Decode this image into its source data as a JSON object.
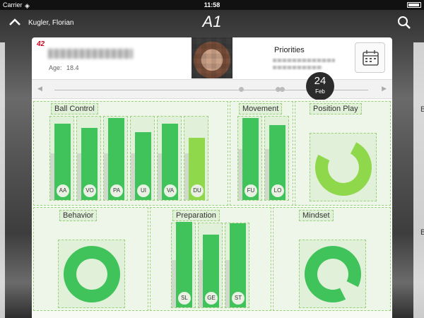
{
  "status": {
    "carrier": "Carrier",
    "time": "11:58"
  },
  "nav": {
    "back_icon": "chevron-up-icon",
    "name": "Kugler, Florian",
    "title": "A1",
    "search_icon": "search-icon"
  },
  "player": {
    "jersey": "42",
    "age_label": "Age:",
    "age_value": "18.4"
  },
  "priorities": {
    "title": "Priorities"
  },
  "timeline": {
    "day": "24",
    "month": "Feb"
  },
  "colors": {
    "green": "#3fc35a",
    "light_green": "#8fd84b",
    "red": "#d0021b"
  },
  "panels": {
    "ball_control": {
      "title": "Ball Control",
      "bars": [
        {
          "label": "AA",
          "value": 0.9,
          "base": 0.55
        },
        {
          "label": "VO",
          "value": 0.85,
          "base": 0.55
        },
        {
          "label": "PA",
          "value": 0.97,
          "base": 0.55
        },
        {
          "label": "UI",
          "value": 0.8,
          "base": 0.55
        },
        {
          "label": "VA",
          "value": 0.9,
          "base": 0.55
        },
        {
          "label": "DU",
          "value": 0.73,
          "base": 0.55
        }
      ]
    },
    "movement": {
      "title": "Movement",
      "bars": [
        {
          "label": "FU",
          "value": 0.97,
          "base": 0.6
        },
        {
          "label": "LO",
          "value": 0.88,
          "base": 0.6
        }
      ]
    },
    "position_play": {
      "title": "Position Play",
      "ring": 0.75
    },
    "behavior": {
      "title": "Behavior",
      "ring": 1.0
    },
    "preparation": {
      "title": "Preparation",
      "bars": [
        {
          "label": "SL",
          "value": 1.0,
          "base": 0.55
        },
        {
          "label": "GE",
          "value": 0.85,
          "base": 0.55
        },
        {
          "label": "ST",
          "value": 0.98,
          "base": 0.55
        }
      ]
    },
    "mindset": {
      "title": "Mindset",
      "ring": 0.9
    }
  },
  "right_card_label": "B"
}
